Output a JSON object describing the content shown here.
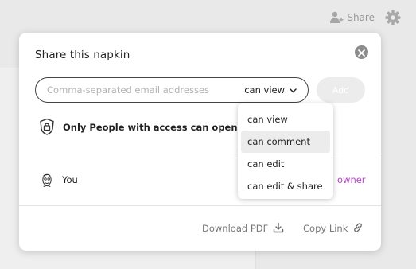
{
  "topbar": {
    "share_label": "Share",
    "share_icon": "add-user-icon",
    "settings_icon": "gear-icon"
  },
  "dialog": {
    "title": "Share this napkin",
    "close_icon": "close-icon",
    "email": {
      "placeholder": "Comma-separated email addresses",
      "value": ""
    },
    "permission": {
      "selected": "can view",
      "icon": "chevron-down-icon",
      "options": [
        "can view",
        "can comment",
        "can edit",
        "can edit & share"
      ],
      "highlighted": "can comment"
    },
    "add_label": "Add",
    "access": {
      "icon": "lock-icon",
      "text": "Only People with access can open the link"
    },
    "members": [
      {
        "name": "You",
        "role": "owner"
      }
    ],
    "footer": {
      "download_label": "Download PDF",
      "download_icon": "download-icon",
      "copy_label": "Copy Link",
      "copy_icon": "link-icon"
    }
  },
  "colors": {
    "owner": "#b446c6",
    "backdrop": "#e9e9e9"
  }
}
